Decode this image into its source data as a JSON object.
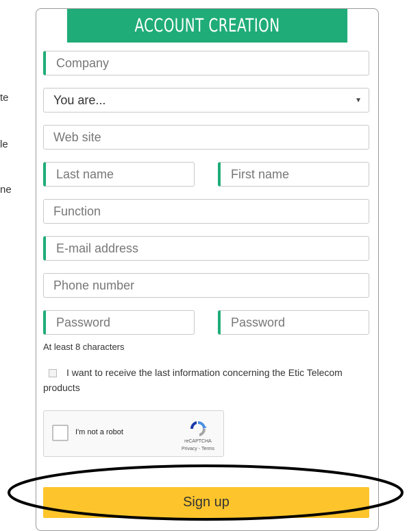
{
  "side_text": [
    "te",
    "le",
    "ne"
  ],
  "header": {
    "title": "ACCOUNT CREATION"
  },
  "form": {
    "company": {
      "placeholder": "Company"
    },
    "you_are": {
      "value": "You are..."
    },
    "website": {
      "placeholder": "Web site"
    },
    "last_name": {
      "placeholder": "Last name"
    },
    "first_name": {
      "placeholder": "First name"
    },
    "function": {
      "placeholder": "Function"
    },
    "email": {
      "placeholder": "E-mail address"
    },
    "phone": {
      "placeholder": "Phone number"
    },
    "password": {
      "placeholder": "Password"
    },
    "password_confirm": {
      "placeholder": "Password"
    },
    "password_hint": "At least 8 characters",
    "newsletter_label": "I want to receive the last information concerning the Etic Telecom products",
    "captcha": {
      "label": "I'm not a robot",
      "brand": "reCAPTCHA",
      "terms": "Privacy - Terms"
    },
    "submit_label": "Sign up"
  },
  "colors": {
    "header_bg": "#1fac78",
    "required_accent": "#1fac78",
    "submit_bg": "#fdc52b",
    "annotation_ellipse": "#000000"
  }
}
